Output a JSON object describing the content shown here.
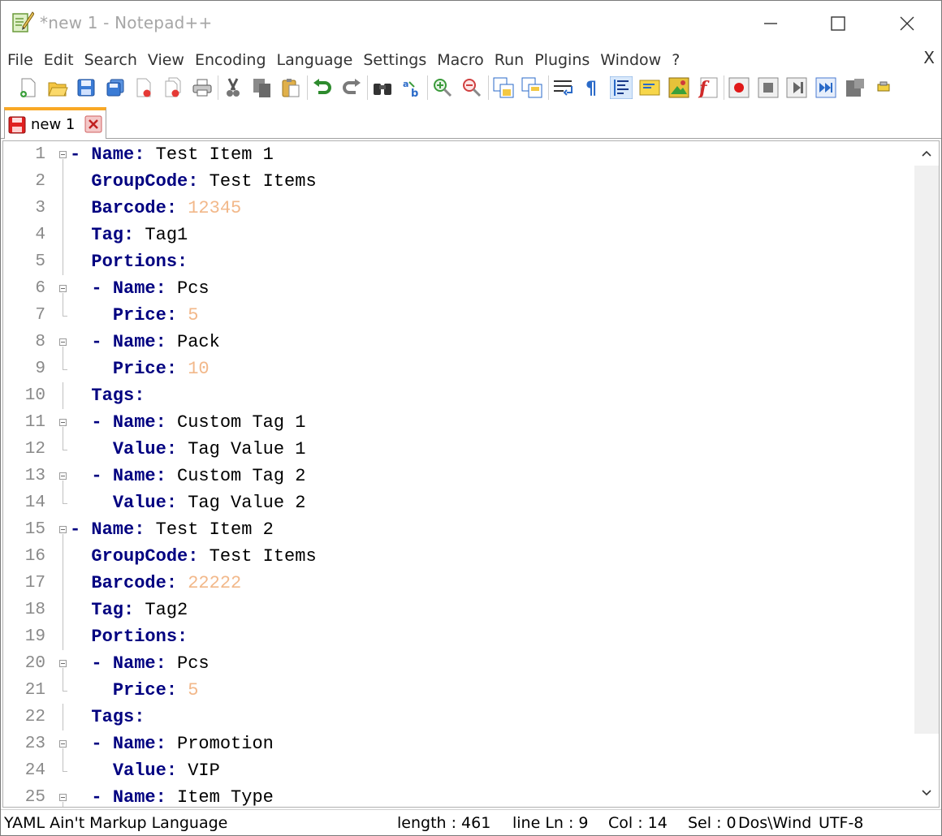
{
  "window": {
    "title": "*new 1 - Notepad++"
  },
  "menu": {
    "items": [
      "File",
      "Edit",
      "Search",
      "View",
      "Encoding",
      "Language",
      "Settings",
      "Macro",
      "Run",
      "Plugins",
      "Window",
      "?"
    ],
    "close_label": "X"
  },
  "toolbar": {
    "icons": [
      "new-file-icon",
      "open-file-icon",
      "save-icon",
      "save-all-icon",
      "close-icon",
      "close-all-icon",
      "print-icon",
      "cut-icon",
      "copy-icon",
      "paste-icon",
      "undo-icon",
      "redo-icon",
      "find-icon",
      "replace-icon",
      "zoom-in-icon",
      "zoom-out-icon",
      "sync-vertical-icon",
      "sync-horizontal-icon",
      "word-wrap-icon",
      "show-all-chars-icon",
      "indent-guide-icon",
      "user-language-icon",
      "document-map-icon",
      "function-list-icon",
      "record-macro-icon",
      "stop-record-icon",
      "playback-macro-icon",
      "run-macro-multiple-icon",
      "save-macro-icon",
      "plugin-icon"
    ]
  },
  "tabs": [
    {
      "label": "new 1",
      "modified": true
    }
  ],
  "editor": {
    "lines": [
      {
        "n": "1",
        "indent": "",
        "dash": "- ",
        "key": "Name",
        "value": "Test Item 1",
        "value_type": "str",
        "fold": "open"
      },
      {
        "n": "2",
        "indent": "  ",
        "dash": "",
        "key": "GroupCode",
        "value": "Test Items",
        "value_type": "str",
        "fold": "line"
      },
      {
        "n": "3",
        "indent": "  ",
        "dash": "",
        "key": "Barcode",
        "value": "12345",
        "value_type": "num",
        "fold": "line"
      },
      {
        "n": "4",
        "indent": "  ",
        "dash": "",
        "key": "Tag",
        "value": "Tag1",
        "value_type": "str",
        "fold": "line"
      },
      {
        "n": "5",
        "indent": "  ",
        "dash": "",
        "key": "Portions",
        "value": "",
        "value_type": "str",
        "fold": "line"
      },
      {
        "n": "6",
        "indent": "  ",
        "dash": "- ",
        "key": "Name",
        "value": "Pcs",
        "value_type": "str",
        "fold": "open"
      },
      {
        "n": "7",
        "indent": "    ",
        "dash": "",
        "key": "Price",
        "value": "5",
        "value_type": "num",
        "fold": "end"
      },
      {
        "n": "8",
        "indent": "  ",
        "dash": "- ",
        "key": "Name",
        "value": "Pack",
        "value_type": "str",
        "fold": "open"
      },
      {
        "n": "9",
        "indent": "    ",
        "dash": "",
        "key": "Price",
        "value": "10",
        "value_type": "num",
        "fold": "end"
      },
      {
        "n": "10",
        "indent": "  ",
        "dash": "",
        "key": "Tags",
        "value": "",
        "value_type": "str",
        "fold": "line"
      },
      {
        "n": "11",
        "indent": "  ",
        "dash": "- ",
        "key": "Name",
        "value": "Custom Tag 1",
        "value_type": "str",
        "fold": "open"
      },
      {
        "n": "12",
        "indent": "    ",
        "dash": "",
        "key": "Value",
        "value": "Tag Value 1",
        "value_type": "str",
        "fold": "end"
      },
      {
        "n": "13",
        "indent": "  ",
        "dash": "- ",
        "key": "Name",
        "value": "Custom Tag 2",
        "value_type": "str",
        "fold": "open"
      },
      {
        "n": "14",
        "indent": "    ",
        "dash": "",
        "key": "Value",
        "value": "Tag Value 2",
        "value_type": "str",
        "fold": "end"
      },
      {
        "n": "15",
        "indent": "",
        "dash": "- ",
        "key": "Name",
        "value": "Test Item 2",
        "value_type": "str",
        "fold": "open"
      },
      {
        "n": "16",
        "indent": "  ",
        "dash": "",
        "key": "GroupCode",
        "value": "Test Items",
        "value_type": "str",
        "fold": "line"
      },
      {
        "n": "17",
        "indent": "  ",
        "dash": "",
        "key": "Barcode",
        "value": "22222",
        "value_type": "num",
        "fold": "line"
      },
      {
        "n": "18",
        "indent": "  ",
        "dash": "",
        "key": "Tag",
        "value": "Tag2",
        "value_type": "str",
        "fold": "line"
      },
      {
        "n": "19",
        "indent": "  ",
        "dash": "",
        "key": "Portions",
        "value": "",
        "value_type": "str",
        "fold": "line"
      },
      {
        "n": "20",
        "indent": "  ",
        "dash": "- ",
        "key": "Name",
        "value": "Pcs",
        "value_type": "str",
        "fold": "open"
      },
      {
        "n": "21",
        "indent": "    ",
        "dash": "",
        "key": "Price",
        "value": "5",
        "value_type": "num",
        "fold": "end"
      },
      {
        "n": "22",
        "indent": "  ",
        "dash": "",
        "key": "Tags",
        "value": "",
        "value_type": "str",
        "fold": "line"
      },
      {
        "n": "23",
        "indent": "  ",
        "dash": "- ",
        "key": "Name",
        "value": "Promotion",
        "value_type": "str",
        "fold": "open"
      },
      {
        "n": "24",
        "indent": "    ",
        "dash": "",
        "key": "Value",
        "value": "VIP",
        "value_type": "str",
        "fold": "end"
      },
      {
        "n": "25",
        "indent": "  ",
        "dash": "- ",
        "key": "Name",
        "value": "Item Type",
        "value_type": "str",
        "fold": "open"
      }
    ]
  },
  "status": {
    "language": "YAML Ain't Markup Language",
    "length": "length : 461",
    "line": "line Ln : 9",
    "col": "Col : 14",
    "sel": "Sel : 0",
    "eol": "Dos\\Wind",
    "encoding": "UTF-8"
  },
  "colors": {
    "keyword": "#000080",
    "number": "#f2b88a",
    "line_number": "#8a8a8a",
    "tab_accent": "#f9a825"
  }
}
